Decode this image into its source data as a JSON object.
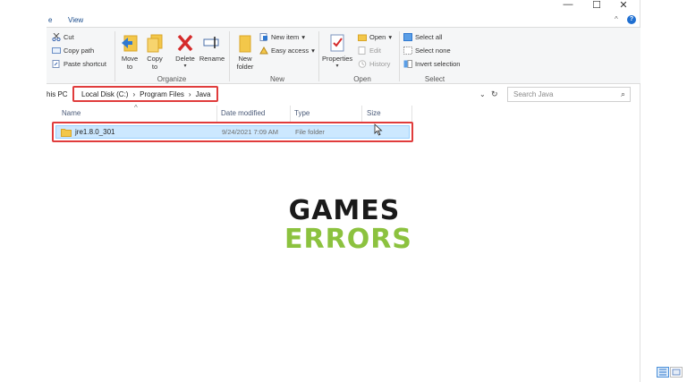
{
  "menu": {
    "partial_tab": "e",
    "view_tab": "View"
  },
  "window_controls": {
    "minimize": "—",
    "maximize": "☐",
    "close": "✕"
  },
  "help_glyph": "?",
  "ribbon": {
    "clipboard": {
      "cut": "Cut",
      "copy_path": "Copy path",
      "paste_shortcut": "Paste shortcut"
    },
    "organize": {
      "label": "Organize",
      "move_to": "Move to",
      "copy_to": "Copy to",
      "delete": "Delete",
      "rename": "Rename"
    },
    "new": {
      "label": "New",
      "new_folder": "New folder",
      "new_item": "New item",
      "easy_access": "Easy access"
    },
    "open": {
      "label": "Open",
      "properties": "Properties",
      "open": "Open",
      "edit": "Edit",
      "history": "History"
    },
    "select": {
      "label": "Select",
      "select_all": "Select all",
      "select_none": "Select none",
      "invert_selection": "Invert selection"
    }
  },
  "address": {
    "this_pc": "his PC",
    "crumbs": [
      "Local Disk (C:)",
      "Program Files",
      "Java"
    ],
    "separator": "›"
  },
  "search": {
    "placeholder": "Search Java"
  },
  "columns": {
    "name": "Name",
    "date_modified": "Date modified",
    "type": "Type",
    "size": "Size"
  },
  "files": [
    {
      "name": "jre1.8.0_301",
      "date_modified": "9/24/2021 7:09 AM",
      "type": "File folder",
      "size": ""
    }
  ],
  "watermark": {
    "line1": "GAMES",
    "line2": "ERRORS"
  },
  "colors": {
    "highlight_border": "#e03c3c",
    "selection_fill": "#cce8ff",
    "watermark_green": "#8cc23f",
    "folder_yellow": "#f3c74a"
  }
}
